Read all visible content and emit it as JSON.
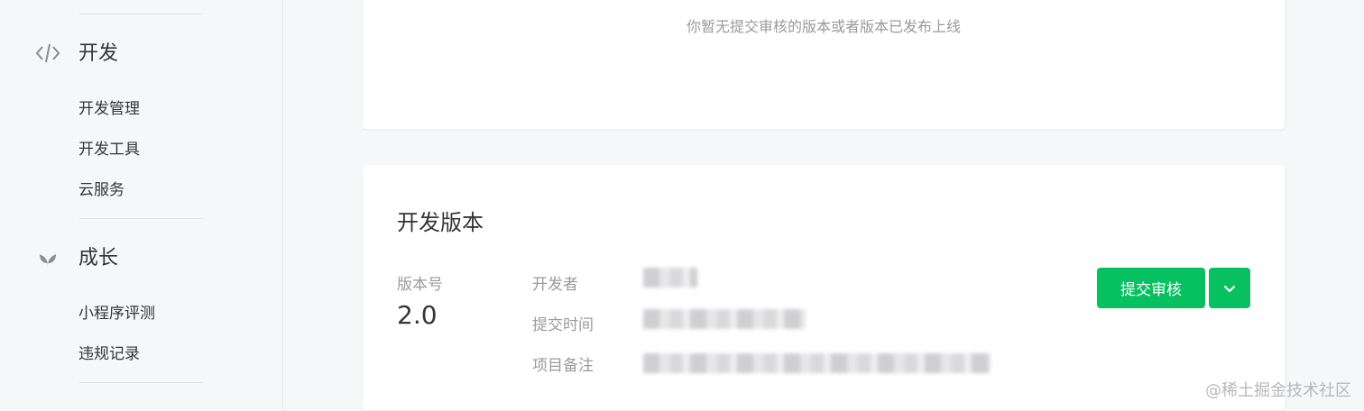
{
  "sidebar": {
    "dev_section": {
      "title": "开发",
      "icon": "code-icon",
      "items": [
        "开发管理",
        "开发工具",
        "云服务"
      ]
    },
    "growth_section": {
      "title": "成长",
      "icon": "sprout-icon",
      "items": [
        "小程序评测",
        "违规记录"
      ]
    }
  },
  "review_card": {
    "empty_tip": "你暂无提交审核的版本或者版本已发布上线"
  },
  "dev_version_card": {
    "title": "开发版本",
    "version_label": "版本号",
    "version_value": "2.0",
    "developer_label": "开发者",
    "submit_time_label": "提交时间",
    "remark_label": "项目备注",
    "submit_button": "提交审核",
    "more_icon": "chevron-down-icon",
    "accent_color": "#07c160"
  },
  "watermark": "@稀土掘金技术社区"
}
